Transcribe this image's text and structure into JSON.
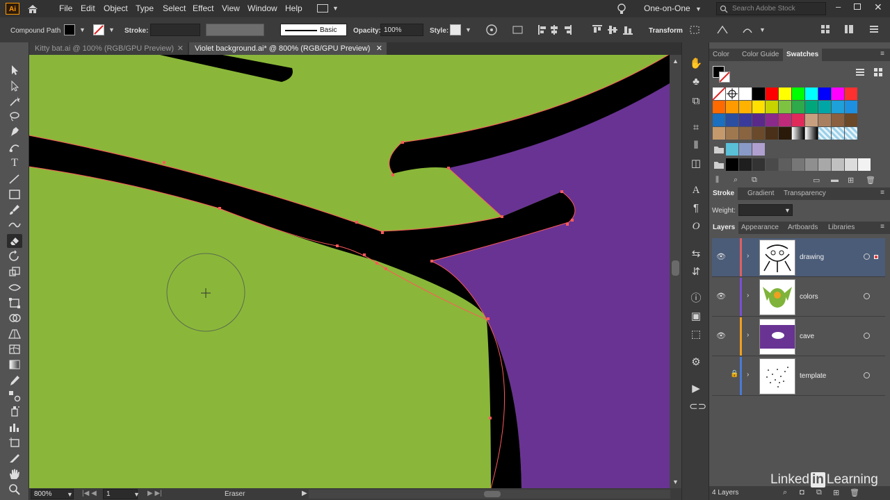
{
  "app": {
    "logo": "Ai"
  },
  "menu": {
    "items": [
      "File",
      "Edit",
      "Object",
      "Type",
      "Select",
      "Effect",
      "View",
      "Window",
      "Help"
    ]
  },
  "workspace": {
    "name": "One-on-One"
  },
  "search": {
    "placeholder": "Search Adobe Stock"
  },
  "control": {
    "selection_label": "Compound Path",
    "stroke_label": "Stroke:",
    "brush_label": "Basic",
    "opacity_label": "Opacity:",
    "opacity_value": "100%",
    "style_label": "Style:",
    "transform_label": "Transform"
  },
  "tabs": [
    {
      "label": "Kitty bat.ai @ 100% (RGB/GPU Preview)",
      "active": false
    },
    {
      "label": "Violet background.ai* @ 800% (RGB/GPU Preview)",
      "active": true
    }
  ],
  "status": {
    "zoom": "800%",
    "artboard": "1",
    "tool": "Eraser"
  },
  "panels": {
    "color_tabs": [
      "Color",
      "Color Guide",
      "Swatches"
    ],
    "stroke_tabs": [
      "Stroke",
      "Gradient",
      "Transparency"
    ],
    "stroke_weight_label": "Weight:",
    "layers_tabs": [
      "Layers",
      "Appearance",
      "Artboards",
      "Libraries"
    ],
    "layers": [
      {
        "name": "drawing",
        "color": "#e06060",
        "visible": true,
        "locked": false,
        "active": true
      },
      {
        "name": "colors",
        "color": "#7a4fd6",
        "visible": true,
        "locked": false,
        "active": false
      },
      {
        "name": "cave",
        "color": "#f0a020",
        "visible": true,
        "locked": false,
        "active": false
      },
      {
        "name": "template",
        "color": "#4a7ad6",
        "visible": false,
        "locked": true,
        "active": false
      }
    ],
    "layers_count": "4 Layers"
  },
  "watermark": {
    "text": "Linked",
    "in": "in",
    "suffix": "Learning"
  },
  "colors": {
    "canvas_green": "#8ab739",
    "canvas_purple": "#693393",
    "path_highlight": "#ff5a5a",
    "accent_blue": "#4b5c78"
  }
}
